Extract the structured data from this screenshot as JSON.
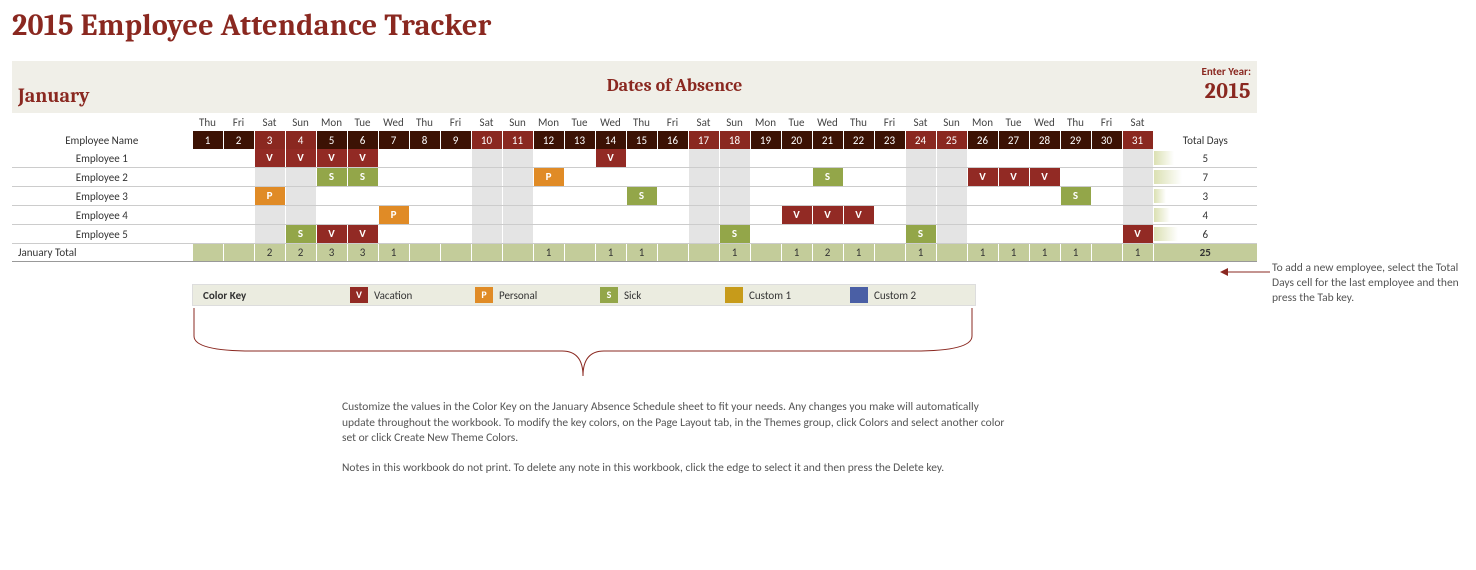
{
  "title": "2015 Employee Attendance Tracker",
  "month": "January",
  "dates_title": "Dates of Absence",
  "enter_year_label": "Enter Year:",
  "year": "2015",
  "name_header": "Employee Name",
  "total_header": "Total Days",
  "total_row_label": "January Total",
  "grand_total": "25",
  "dow": [
    "Thu",
    "Fri",
    "Sat",
    "Sun",
    "Mon",
    "Tue",
    "Wed",
    "Thu",
    "Fri",
    "Sat",
    "Sun",
    "Mon",
    "Tue",
    "Wed",
    "Thu",
    "Fri",
    "Sat",
    "Sun",
    "Mon",
    "Tue",
    "Wed",
    "Thu",
    "Fri",
    "Sat",
    "Sun",
    "Mon",
    "Tue",
    "Wed",
    "Thu",
    "Fri",
    "Sat"
  ],
  "daynums": [
    "1",
    "2",
    "3",
    "4",
    "5",
    "6",
    "7",
    "8",
    "9",
    "10",
    "11",
    "12",
    "13",
    "14",
    "15",
    "16",
    "17",
    "18",
    "19",
    "20",
    "21",
    "22",
    "23",
    "24",
    "25",
    "26",
    "27",
    "28",
    "29",
    "30",
    "31"
  ],
  "weekend_idx": [
    2,
    3,
    9,
    10,
    16,
    17,
    23,
    24,
    30
  ],
  "employees": [
    {
      "name": "Employee 1",
      "total": "5",
      "bar": 20,
      "cells": {
        "2": "V",
        "3": "V",
        "4": "V",
        "5": "V",
        "13": "V"
      }
    },
    {
      "name": "Employee 2",
      "total": "7",
      "bar": 28,
      "cells": {
        "4": "S",
        "5": "S",
        "11": "P",
        "20": "S",
        "25": "V",
        "26": "V",
        "27": "V"
      }
    },
    {
      "name": "Employee 3",
      "total": "3",
      "bar": 12,
      "cells": {
        "2": "P",
        "14": "S",
        "28": "S"
      }
    },
    {
      "name": "Employee 4",
      "total": "4",
      "bar": 16,
      "cells": {
        "6": "P",
        "19": "V",
        "20": "V",
        "21": "V"
      }
    },
    {
      "name": "Employee 5",
      "total": "6",
      "bar": 24,
      "cells": {
        "3": "S",
        "4": "V",
        "5": "V",
        "17": "S",
        "23": "S",
        "30": "V"
      }
    }
  ],
  "col_totals": [
    "",
    "",
    "2",
    "2",
    "3",
    "3",
    "1",
    "",
    "",
    "",
    "",
    "1",
    "",
    "1",
    "1",
    "",
    "",
    "1",
    "",
    "1",
    "2",
    "1",
    "",
    "1",
    "",
    "1",
    "1",
    "1",
    "1",
    "",
    "1"
  ],
  "colorkey": {
    "label": "Color Key",
    "entries": [
      {
        "code": "V",
        "label": "Vacation",
        "class": "c-V"
      },
      {
        "code": "P",
        "label": "Personal",
        "class": "c-P"
      },
      {
        "code": "S",
        "label": "Sick",
        "class": "c-S"
      },
      {
        "code": "",
        "label": "Custom 1",
        "class": "c-C1"
      },
      {
        "code": "",
        "label": "Custom 2",
        "class": "c-C2"
      }
    ]
  },
  "note_main_p1": "Customize the values in the Color Key on the January Absence Schedule sheet to fit your needs. Any changes you make will automatically update throughout the workbook.  To modify the key colors, on the Page Layout tab,  in the Themes group, click Colors and select another color set or click Create New Theme Colors.",
  "note_main_p2": "Notes in this workbook do not print. To delete any note in this workbook, click the edge to select it and then press the Delete key.",
  "side_note": "To add a new employee, select the Total Days cell for the last employee and then press the Tab key."
}
